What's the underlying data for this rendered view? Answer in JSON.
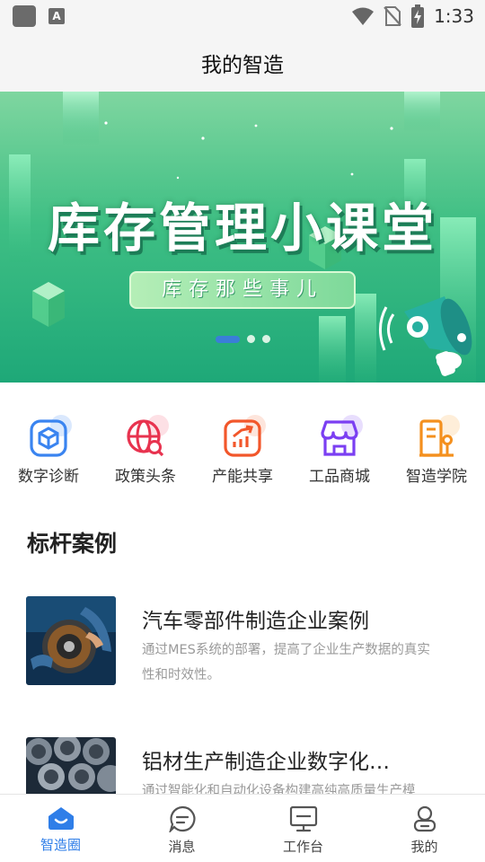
{
  "status_bar": {
    "time": "1:33",
    "icons": [
      "app-square-icon",
      "a-badge-icon",
      "wifi-icon",
      "no-sim-icon",
      "battery-charging-icon"
    ]
  },
  "header": {
    "title": "我的智造"
  },
  "banner": {
    "title": "库存管理小课堂",
    "subtitle": "库存那些事儿",
    "slides": 3,
    "active_slide": 1,
    "colors": {
      "top": "#7fd6a0",
      "bottom": "#1ea878",
      "dot_active": "#3a7ed8"
    }
  },
  "quick_nav": [
    {
      "label": "数字诊断",
      "icon": "cube-scan-icon",
      "color": "#3a84f0"
    },
    {
      "label": "政策头条",
      "icon": "globe-search-icon",
      "color": "#e8334f"
    },
    {
      "label": "产能共享",
      "icon": "growth-chart-icon",
      "color": "#f2572b"
    },
    {
      "label": "工品商城",
      "icon": "storefront-icon",
      "color": "#7b3ff2"
    },
    {
      "label": "智造学院",
      "icon": "building-icon",
      "color": "#f4901e"
    }
  ],
  "cases": {
    "section_title": "标杆案例",
    "items": [
      {
        "title": "汽车零部件制造企业案例",
        "desc": "通过MES系统的部署，提高了企业生产数据的真实性和时效性。"
      },
      {
        "title": "铝材生产制造企业数字化…",
        "desc": "通过智能化和自动化设备构建高纯高质量生产模"
      }
    ]
  },
  "bottom_nav": [
    {
      "label": "智造圈",
      "icon": "home-smile-icon",
      "active": true
    },
    {
      "label": "消息",
      "icon": "message-icon",
      "active": false
    },
    {
      "label": "工作台",
      "icon": "monitor-icon",
      "active": false
    },
    {
      "label": "我的",
      "icon": "user-icon",
      "active": false
    }
  ],
  "accent": "#2f7ee8"
}
